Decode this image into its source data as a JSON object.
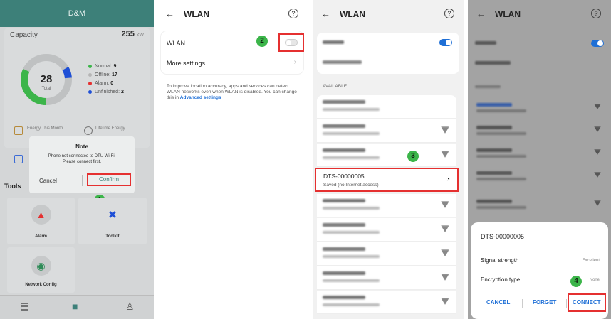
{
  "panel1": {
    "app_title": "D&M",
    "capacity_label": "Capacity",
    "capacity_value": "255",
    "capacity_unit": "kW",
    "total_value": "28",
    "total_label": "Total",
    "legend": [
      {
        "label": "Normal:",
        "value": "9",
        "color": "#3cb54a"
      },
      {
        "label": "Offline:",
        "value": "17",
        "color": "#b5b5b5"
      },
      {
        "label": "Alarm:",
        "value": "0",
        "color": "#e53030"
      },
      {
        "label": "Unfinished:",
        "value": "2",
        "color": "#1e4fd6"
      }
    ],
    "energy_label": "Energy This Month",
    "lifetime_label": "Lifetime Energy",
    "dialog": {
      "title": "Note",
      "message_line1": "Phone not connected to DTU Wi-Fi.",
      "message_line2": "Please connect first.",
      "cancel": "Cancel",
      "confirm": "Confirm"
    },
    "tools_label": "Tools",
    "tiles": [
      {
        "label": "Alarm",
        "icon": "alarm-bell-icon"
      },
      {
        "label": "Toolkit",
        "icon": "toolkit-icon"
      },
      {
        "label": "Network Config",
        "icon": "wifi-config-icon"
      }
    ],
    "nav_icons": [
      "grid-icon",
      "apps-icon",
      "user-icon"
    ],
    "step": "1"
  },
  "panel2": {
    "title": "WLAN",
    "wlan_label": "WLAN",
    "more_settings": "More settings",
    "help_text": "To improve location accuracy, apps and services can detect WLAN networks even when WLAN is disabled. You can change this in",
    "help_link": "Advanced settings",
    "step": "2"
  },
  "panel3": {
    "title": "WLAN",
    "available_label": "AVAILABLE",
    "selected_network": "DTS-00000005",
    "selected_status": "Saved (no Internet access)",
    "step": "3"
  },
  "panel4": {
    "title": "WLAN",
    "sheet_title": "DTS-00000005",
    "signal_label": "Signal strength",
    "signal_value": "Excellent",
    "encryption_label": "Encryption type",
    "encryption_value": "None",
    "cancel": "CANCEL",
    "forget": "FORGET",
    "connect": "CONNECT",
    "step": "4"
  }
}
